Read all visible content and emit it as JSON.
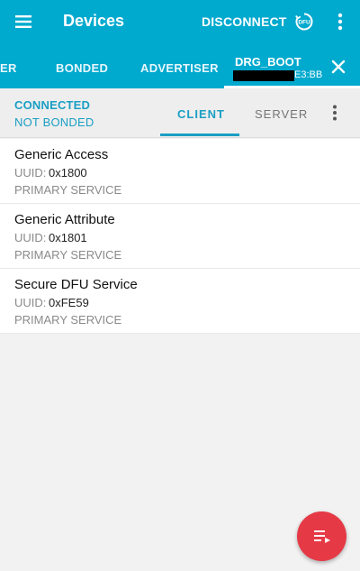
{
  "appbar": {
    "title": "Devices",
    "disconnect_label": "DISCONNECT",
    "dfu_label": "DFU"
  },
  "tabs": {
    "partial_label": "ER",
    "bonded_label": "BONDED",
    "advertiser_label": "ADVERTISER",
    "device_name": "DRG_BOOT",
    "device_addr_suffix": "E3:BB"
  },
  "connection": {
    "status": "CONNECTED",
    "bond": "NOT BONDED"
  },
  "subtabs": {
    "client": "CLIENT",
    "server": "SERVER"
  },
  "services": [
    {
      "name": "Generic Access",
      "uuid_label": "UUID:",
      "uuid": "0x1800",
      "type": "PRIMARY SERVICE"
    },
    {
      "name": "Generic Attribute",
      "uuid_label": "UUID:",
      "uuid": "0x1801",
      "type": "PRIMARY SERVICE"
    },
    {
      "name": "Secure DFU Service",
      "uuid_label": "UUID:",
      "uuid": "0xFE59",
      "type": "PRIMARY SERVICE"
    }
  ],
  "colors": {
    "primary": "#00a9ce",
    "accent": "#1a9fc4",
    "fab": "#e63946"
  },
  "icons": {
    "menu": "menu-icon",
    "dfu": "dfu-icon",
    "overflow": "more-vert-icon",
    "close": "close-icon",
    "fab": "log-list-icon"
  }
}
